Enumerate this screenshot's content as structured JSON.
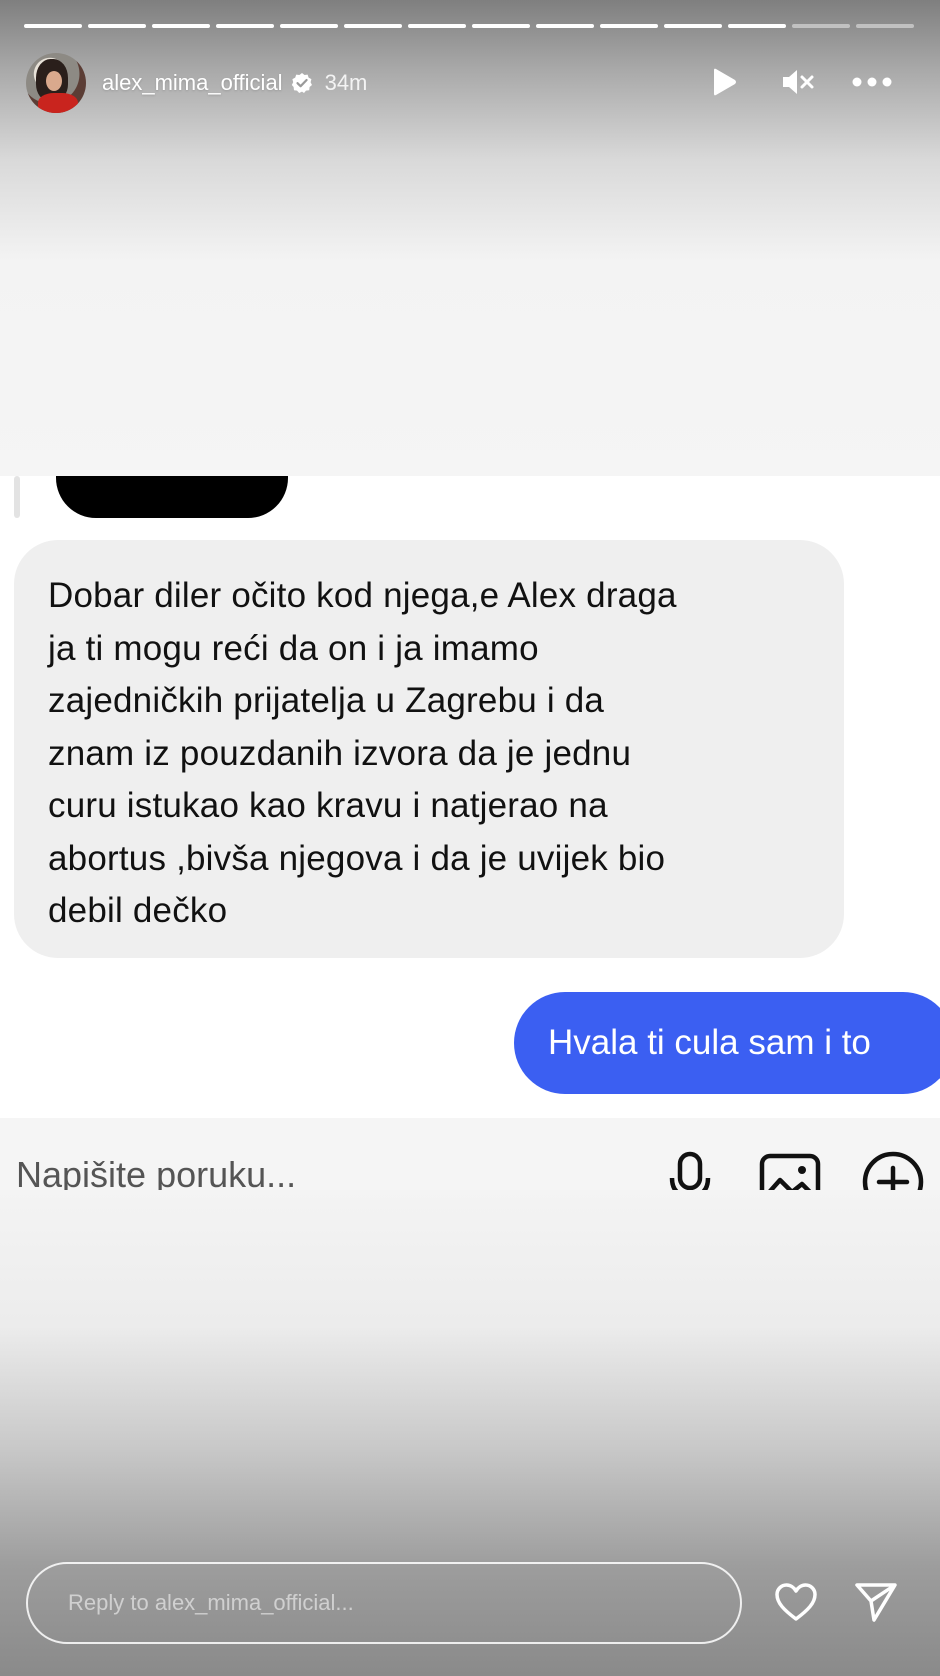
{
  "story": {
    "progress_total": 14,
    "progress_done": 12,
    "username": "alex_mima_official",
    "verified": true,
    "time_ago": "34m"
  },
  "header_controls": {
    "play_icon": "play-icon",
    "mute_icon": "mute-icon",
    "more_icon": "more-icon"
  },
  "conversation": {
    "incoming_lines": [
      "Dobar diler očito kod njega,e Alex draga",
      "ja ti mogu reći da on i ja imamo",
      "zajedničkih prijatelja u Zagrebu i da",
      "znam iz pouzdanih izvora da je jednu",
      "curu istukao kao kravu i natjerao na",
      "abortus ,bivša njegova i da je uvijek bio",
      "debil dečko"
    ],
    "outgoing_message": "Hvala ti cula sam i to"
  },
  "composer": {
    "placeholder": "Napišite poruku...",
    "icons": [
      "microphone-icon",
      "image-icon",
      "add-icon"
    ]
  },
  "reply": {
    "placeholder": "Reply to alex_mima_official...",
    "icons": [
      "heart-icon",
      "send-icon"
    ]
  },
  "colors": {
    "outgoing_bubble": "#3b5ff2",
    "incoming_bubble": "#efefef"
  }
}
